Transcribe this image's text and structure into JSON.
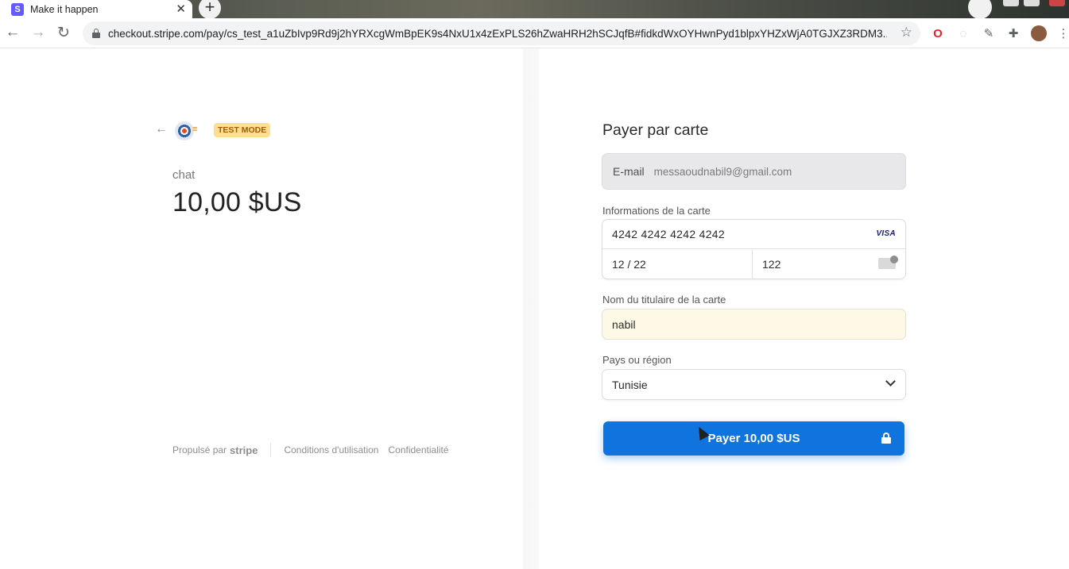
{
  "browser": {
    "tab_title": "Make it happen",
    "tab_favicon_letter": "S",
    "url": "checkout.stripe.com/pay/cs_test_a1uZbIvp9Rd9j2hYRXcgWmBpEK9s4NxU1x4zExPLS26hZwaHRH2hSCJqfB#fidkdWxOYHwnPyd1blpxYHZxWjA0TGJXZ3RDM3..."
  },
  "summary": {
    "badge": "TEST MODE",
    "product_name": "chat",
    "price": "10,00 $US",
    "footer": {
      "powered_prefix": "Propulsé par",
      "powered_brand": "stripe",
      "terms": "Conditions d'utilisation",
      "privacy": "Confidentialité"
    }
  },
  "form": {
    "title": "Payer par carte",
    "email_label": "E-mail",
    "email_value": "messaoudnabil9@gmail.com",
    "card_label": "Informations de la carte",
    "card_number": "4242 4242 4242 4242",
    "card_brand": "VISA",
    "expiry": "12 / 22",
    "cvc": "122",
    "name_label": "Nom du titulaire de la carte",
    "name_value": "nabil",
    "country_label": "Pays ou région",
    "country_value": "Tunisie",
    "pay_button": "Payer 10,00 $US"
  },
  "colors": {
    "accent": "#0f74de",
    "test_badge_bg": "#ffde92",
    "test_badge_text": "#a15c00"
  }
}
